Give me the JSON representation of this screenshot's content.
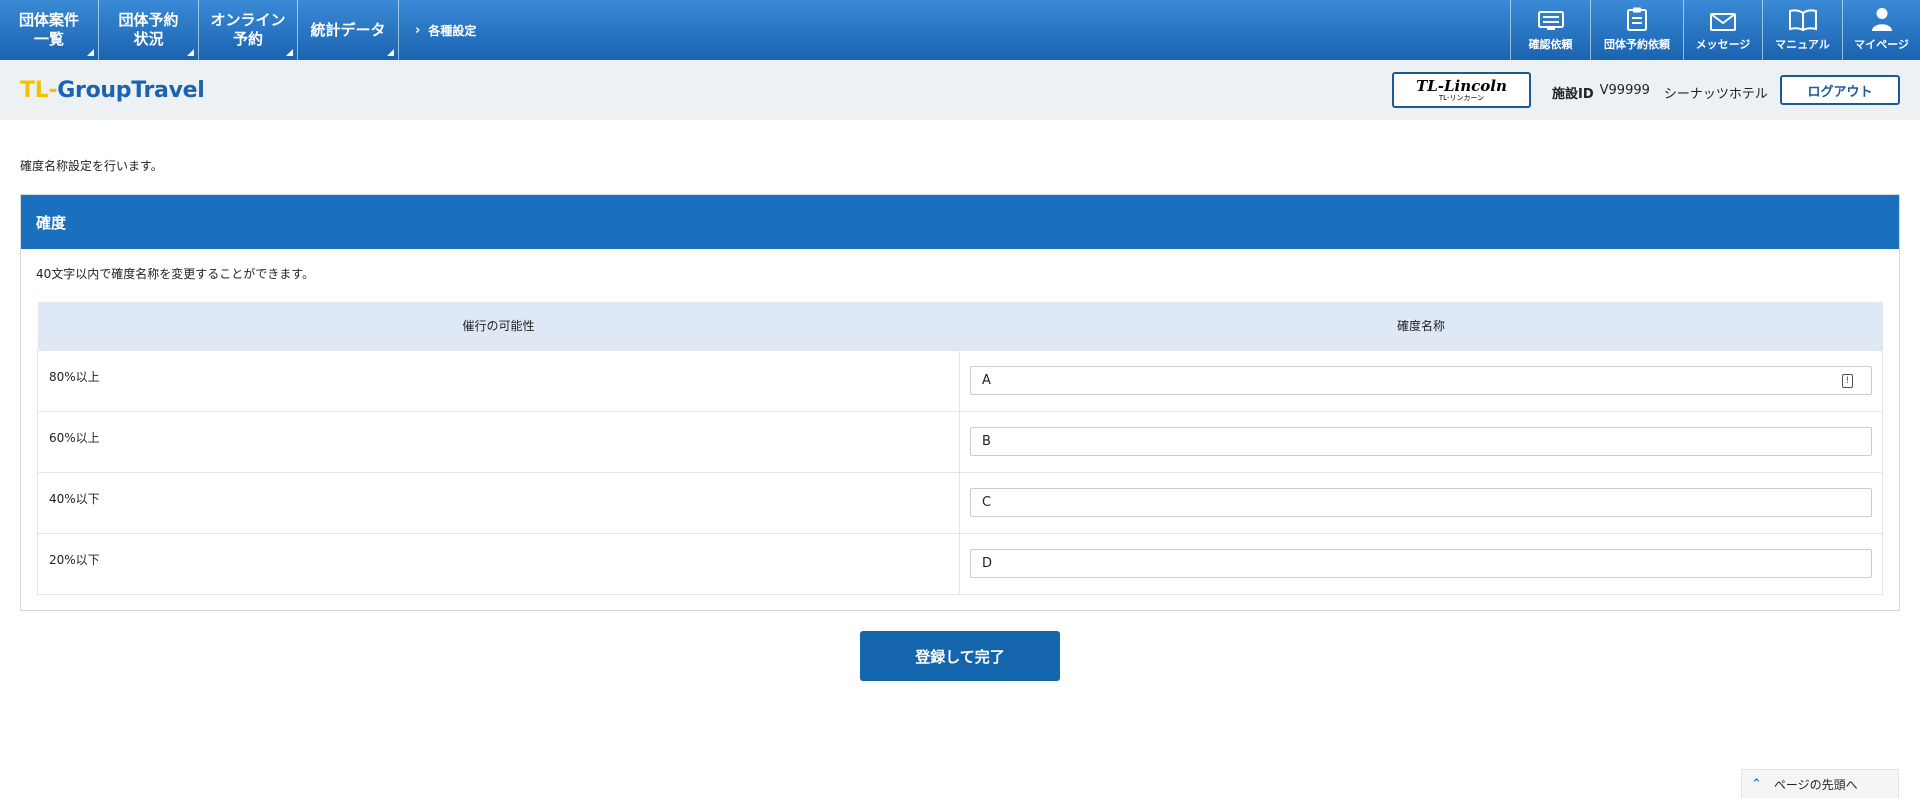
{
  "nav": {
    "items": [
      {
        "line1": "団体案件",
        "line2": "一覧"
      },
      {
        "line1": "団体予約",
        "line2": "状況"
      },
      {
        "line1": "オンライン",
        "line2": "予約"
      },
      {
        "line1": "統計データ",
        "line2": ""
      }
    ],
    "breadcrumb": "各種設定",
    "icons": [
      {
        "label": "確認依頼",
        "icon": "checklist-monitor-icon"
      },
      {
        "label": "団体予約依頼",
        "icon": "clipboard-icon"
      },
      {
        "label": "メッセージ",
        "icon": "envelope-icon"
      },
      {
        "label": "マニュアル",
        "icon": "book-icon"
      },
      {
        "label": "マイページ",
        "icon": "user-icon"
      }
    ]
  },
  "header": {
    "brand_tl": "TL-",
    "brand_rest": "GroupTravel",
    "lincoln_main": "TL-Lincoln",
    "lincoln_sub": "TL-リンカーン",
    "facility_label": "施設ID",
    "facility_id": "V99999",
    "facility_name": "シーナッツホテル",
    "logout": "ログアウト"
  },
  "main": {
    "intro": "確度名称設定を行います。",
    "panel_title": "確度",
    "note": "40文字以内で確度名称を変更することができます。",
    "columns": [
      "催行の可能性",
      "確度名称"
    ],
    "rows": [
      {
        "label": "80%以上",
        "value": "A"
      },
      {
        "label": "60%以上",
        "value": "B"
      },
      {
        "label": "40%以下",
        "value": "C"
      },
      {
        "label": "20%以下",
        "value": "D"
      }
    ],
    "submit": "登録して完了",
    "page_top": "ページの先頭へ"
  },
  "colors": {
    "nav_top": "#3a8ad6",
    "nav_bottom": "#1a63b0",
    "panel_header": "#1a6fbf",
    "table_header": "#dfe9f6",
    "button": "#1565ad",
    "brand_yellow": "#f2c200"
  }
}
